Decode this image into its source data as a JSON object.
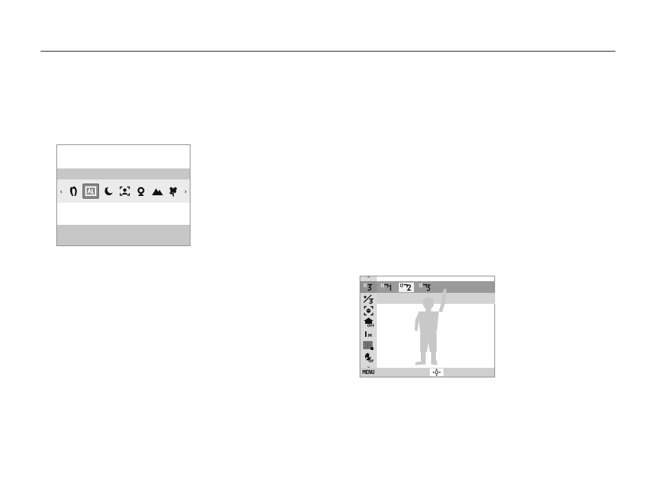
{
  "scene_panel": {
    "left_arrow": "‹",
    "right_arrow": "›",
    "modes": [
      {
        "icon": "beauty-shot-icon",
        "selected": false
      },
      {
        "icon": "frame-guide-icon",
        "selected": true
      },
      {
        "icon": "night-icon",
        "selected": false
      },
      {
        "icon": "portrait-icon",
        "selected": false
      },
      {
        "icon": "children-icon",
        "selected": false
      },
      {
        "icon": "landscape-icon",
        "selected": false
      },
      {
        "icon": "close-up-icon",
        "selected": false
      }
    ]
  },
  "style_panel": {
    "up_arrow": "⌃",
    "down_arrow": "⌄",
    "menu_items": [
      {
        "icon": "custom-color-icon",
        "active": true
      },
      {
        "icon": "exposure-compensation-icon",
        "active": false
      },
      {
        "icon": "face-detection-icon",
        "active": false
      },
      {
        "icon": "flash-off-icon",
        "active": false
      },
      {
        "icon": "resolution-icon",
        "active": false
      },
      {
        "icon": "quality-icon",
        "active": false
      },
      {
        "icon": "ois-off-icon",
        "active": false
      }
    ],
    "options": [
      {
        "icon": "custom-1-icon",
        "selected": false
      },
      {
        "icon": "custom-2-icon",
        "selected": true
      },
      {
        "icon": "custom-3-icon",
        "selected": false
      }
    ],
    "menu_label": "MENU",
    "move_icon": "four-way-arrow-icon"
  }
}
